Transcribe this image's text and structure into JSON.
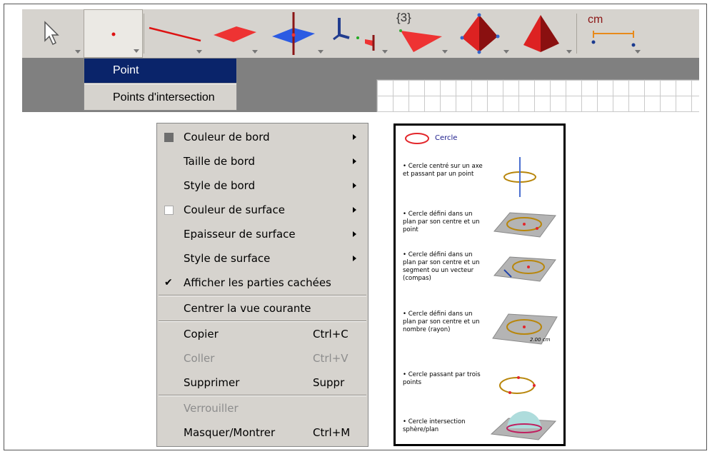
{
  "toolbar": {
    "tools": [
      {
        "name": "pointer"
      },
      {
        "name": "point"
      },
      {
        "name": "segment"
      },
      {
        "name": "plane"
      },
      {
        "name": "perpendicular-plane"
      },
      {
        "name": "axes"
      },
      {
        "name": "polygon",
        "badge": "{3}"
      },
      {
        "name": "tetrahedron"
      },
      {
        "name": "pyramid"
      },
      {
        "name": "measure",
        "badge": "cm"
      }
    ]
  },
  "point_dropdown": {
    "items": [
      {
        "label": "Point",
        "selected": true
      },
      {
        "label": "Points d'intersection",
        "selected": false
      }
    ]
  },
  "context_menu": {
    "items": [
      {
        "label": "Couleur de bord",
        "submenu": true,
        "swatch": "#6e6e6e"
      },
      {
        "label": "Taille de bord",
        "submenu": true
      },
      {
        "label": "Style de bord",
        "submenu": true
      },
      {
        "label": "Couleur de surface",
        "submenu": true,
        "swatch": "#ffffff"
      },
      {
        "label": "Epaisseur de surface",
        "submenu": true
      },
      {
        "label": "Style de surface",
        "submenu": true
      },
      {
        "label": "Afficher les parties cachées",
        "checked": true
      },
      {
        "label": "Centrer la vue courante"
      },
      {
        "label": "Copier",
        "shortcut": "Ctrl+C"
      },
      {
        "label": "Coller",
        "shortcut": "Ctrl+V",
        "disabled": true
      },
      {
        "label": "Supprimer",
        "shortcut": "Suppr"
      },
      {
        "label": "Verrouiller",
        "disabled": true
      },
      {
        "label": "Masquer/Montrer",
        "shortcut": "Ctrl+M"
      }
    ]
  },
  "help_panel": {
    "title": "Cercle",
    "entries": [
      {
        "text": "• Cercle centré sur un axe et passant par un point"
      },
      {
        "text": "• Cercle défini dans un plan par son centre et un point"
      },
      {
        "text": "• Cercle défini dans un plan par son centre et un segment ou un vecteur (compas)"
      },
      {
        "text": "• Cercle défini dans un plan par son centre et un nombre (rayon)",
        "image_label": "2.00 cm"
      },
      {
        "text": "• Cercle passant par trois points"
      },
      {
        "text": "• Cercle intersection sphère/plan"
      }
    ]
  },
  "colors": {
    "toolbar_bg": "#d6d3ce",
    "selection": "#0a246a",
    "circle": "#c88a1a",
    "red": "#e3262b"
  }
}
